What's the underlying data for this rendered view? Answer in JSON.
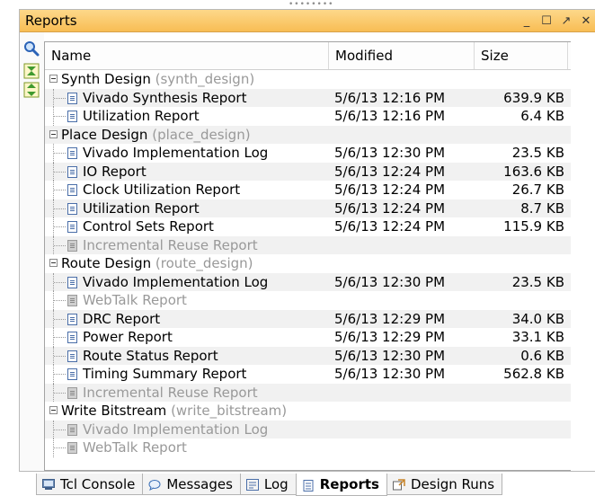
{
  "panel": {
    "title": "Reports",
    "window_buttons": [
      "_",
      "☐",
      "↗",
      "✕"
    ]
  },
  "toolbar": {
    "icons": [
      "search-icon",
      "collapse-all-icon",
      "expand-all-icon"
    ]
  },
  "table": {
    "columns": [
      "Name",
      "Modified",
      "Size"
    ],
    "groups": [
      {
        "name": "Synth Design",
        "run": "(synth_design)",
        "items": [
          {
            "name": "Vivado Synthesis Report",
            "modified": "5/6/13 12:16 PM",
            "size": "639.9 KB",
            "available": true
          },
          {
            "name": "Utilization Report",
            "modified": "5/6/13 12:16 PM",
            "size": "6.4 KB",
            "available": true
          }
        ]
      },
      {
        "name": "Place Design",
        "run": "(place_design)",
        "items": [
          {
            "name": "Vivado Implementation Log",
            "modified": "5/6/13 12:30 PM",
            "size": "23.5 KB",
            "available": true
          },
          {
            "name": "IO Report",
            "modified": "5/6/13 12:24 PM",
            "size": "163.6 KB",
            "available": true
          },
          {
            "name": "Clock Utilization Report",
            "modified": "5/6/13 12:24 PM",
            "size": "26.7 KB",
            "available": true
          },
          {
            "name": "Utilization Report",
            "modified": "5/6/13 12:24 PM",
            "size": "8.7 KB",
            "available": true
          },
          {
            "name": "Control Sets Report",
            "modified": "5/6/13 12:24 PM",
            "size": "115.9 KB",
            "available": true
          },
          {
            "name": "Incremental Reuse Report",
            "modified": "",
            "size": "",
            "available": false
          }
        ]
      },
      {
        "name": "Route Design",
        "run": "(route_design)",
        "items": [
          {
            "name": "Vivado Implementation Log",
            "modified": "5/6/13 12:30 PM",
            "size": "23.5 KB",
            "available": true
          },
          {
            "name": "WebTalk Report",
            "modified": "",
            "size": "",
            "available": false
          },
          {
            "name": "DRC Report",
            "modified": "5/6/13 12:29 PM",
            "size": "34.0 KB",
            "available": true
          },
          {
            "name": "Power Report",
            "modified": "5/6/13 12:29 PM",
            "size": "33.1 KB",
            "available": true
          },
          {
            "name": "Route Status Report",
            "modified": "5/6/13 12:30 PM",
            "size": "0.6 KB",
            "available": true
          },
          {
            "name": "Timing Summary Report",
            "modified": "5/6/13 12:30 PM",
            "size": "562.8 KB",
            "available": true
          },
          {
            "name": "Incremental Reuse Report",
            "modified": "",
            "size": "",
            "available": false
          }
        ]
      },
      {
        "name": "Write Bitstream",
        "run": "(write_bitstream)",
        "items": [
          {
            "name": "Vivado Implementation Log",
            "modified": "",
            "size": "",
            "available": false
          },
          {
            "name": "WebTalk Report",
            "modified": "",
            "size": "",
            "available": false
          }
        ]
      }
    ]
  },
  "bottom_tabs": [
    {
      "label": "Tcl Console",
      "icon": "console-icon",
      "active": false
    },
    {
      "label": "Messages",
      "icon": "speech-bubble-icon",
      "active": false
    },
    {
      "label": "Log",
      "icon": "log-icon",
      "active": false
    },
    {
      "label": "Reports",
      "icon": "report-icon",
      "active": true
    },
    {
      "label": "Design Runs",
      "icon": "design-runs-icon",
      "active": false
    }
  ],
  "colors": {
    "title_bar": "#f8bd54",
    "active_tab": "#ffffff",
    "dim_text": "#999999",
    "doc_icon": "#4a6ea8"
  }
}
